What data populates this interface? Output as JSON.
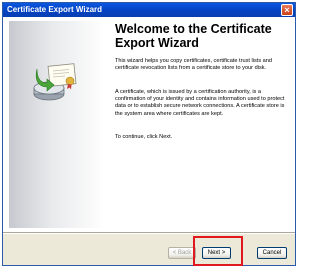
{
  "window": {
    "title": "Certificate Export Wizard",
    "close_glyph": "×"
  },
  "wizard": {
    "heading": "Welcome to the Certificate Export Wizard",
    "paragraphs": [
      "This wizard helps you copy certificates, certificate trust lists and certificate revocation lists from a certificate store to your disk.",
      "A certificate, which is issued by a certification authority, is a confirmation of your identity and contains information used to protect data or to establish secure network connections. A certificate store is the system area where certificates are kept.",
      "To continue, click Next."
    ],
    "graphic_icon": "certificate-export-icon"
  },
  "buttons": {
    "back_label": "< Back",
    "next_label": "Next >",
    "cancel_label": "Cancel",
    "back_enabled": false
  },
  "annotation": {
    "highlight_color": "#e0191f",
    "highlight_target": "next-button"
  },
  "colors": {
    "titlebar": "#0544c4",
    "dialog_bg": "#ece9d8",
    "content_bg": "#ffffff"
  }
}
